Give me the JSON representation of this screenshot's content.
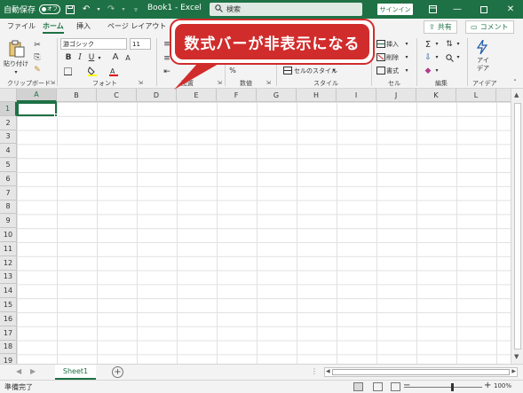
{
  "titlebar": {
    "autosave_label": "自動保存",
    "autosave_state": "オフ",
    "title": "Book1 - Excel",
    "search_placeholder": "検索",
    "signin": "サインイン"
  },
  "tabs": [
    "ファイル",
    "ホーム",
    "挿入",
    "ページ レイアウト"
  ],
  "active_tab": "ホーム",
  "share_label": "共有",
  "comment_label": "コメント",
  "ribbon": {
    "paste_label": "貼り付け",
    "font_name": "游ゴシック",
    "font_size": "11",
    "bold": "B",
    "italic": "I",
    "underline": "U",
    "grow_font": "A",
    "shrink_font": "A",
    "cell_style": "セルのスタイル",
    "insert": "挿入",
    "delete": "削除",
    "format": "書式",
    "ideas_label": "アイ\nデア",
    "groups": [
      "クリップボード",
      "フォント",
      "配置",
      "数値",
      "スタイル",
      "セル",
      "編集",
      "アイデア"
    ]
  },
  "callout": "数式バーが非表示になる",
  "columns": [
    "A",
    "B",
    "C",
    "D",
    "E",
    "F",
    "G",
    "H",
    "I",
    "J",
    "K",
    "L",
    "M"
  ],
  "rows": [
    "1",
    "2",
    "3",
    "4",
    "5",
    "6",
    "7",
    "8",
    "9",
    "10",
    "11",
    "12",
    "13",
    "14",
    "15",
    "16",
    "17",
    "18",
    "19"
  ],
  "active_cell": "A1",
  "sheet": {
    "name": "Sheet1"
  },
  "status": {
    "text": "準備完了",
    "zoom": "100%"
  },
  "colors": {
    "excel_green": "#1e7145",
    "callout_red": "#d12c2c"
  }
}
